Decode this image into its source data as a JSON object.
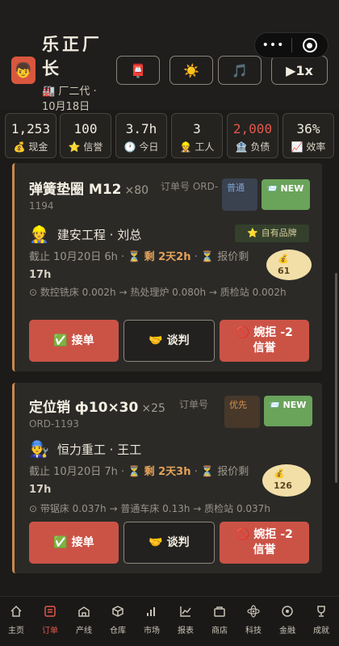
{
  "header": {
    "title": "乐正厂长",
    "subtitle_factory_emoji": "🏭",
    "subtitle_line": "厂二代 ·",
    "date": "10月18日",
    "avatar_emoji": "👦",
    "buttons": {
      "mail": "📮",
      "weather": "☀️",
      "music": "🎵",
      "speed": "▶1x"
    },
    "capsule_dots": "•••"
  },
  "stats": [
    {
      "value": "1,253",
      "icon": "💰",
      "label": "现金"
    },
    {
      "value": "100",
      "icon": "⭐",
      "label": "信誉"
    },
    {
      "value": "3.7h",
      "icon": "🕐",
      "label": "今日"
    },
    {
      "value": "3",
      "icon": "👷",
      "label": "工人"
    },
    {
      "value": "2,000",
      "icon": "🏦",
      "label": "负债",
      "color": "#e2574a"
    },
    {
      "value": "36%",
      "icon": "📈",
      "label": "效率"
    }
  ],
  "orders": [
    {
      "title": "弹簧垫圈 M12",
      "qty": "×80",
      "order_label": "订单号 ORD-",
      "order_num": "1194",
      "tag_priority": "普通",
      "tag_new": "📨 NEW",
      "client_emoji": "👷",
      "client": "建安工程 · 刘总",
      "brand": "⭐ 自有品牌",
      "deadline_prefix": "截止 10月20日 6h · ⏳",
      "remaining": "剩 2天2h",
      "quote_prefix": "· ⏳ 报价剩",
      "quote_time": "17h",
      "price_icon": "💰",
      "price": "61",
      "route": "⊙ 数控铣床 0.002h → 热处理炉 0.080h → 质检站 0.002h",
      "accept": "✅ 接单",
      "negotiate": "🤝 谈判",
      "reject": "🚫 婉拒 -2 信誉"
    },
    {
      "title": "定位销 ф10×30",
      "qty": "×25",
      "order_label": "订单号",
      "order_num": "ORD-1193",
      "tag_priority": "优先",
      "tag_new": "📨 NEW",
      "client_emoji": "👨‍🔧",
      "client": "恒力重工 · 王工",
      "deadline_prefix": "截止 10月20日 7h · ⏳",
      "remaining": "剩 2天3h",
      "quote_prefix": "· ⏳ 报价剩",
      "quote_time": "17h",
      "price_icon": "💰",
      "price": "126",
      "route": "⊙ 带锯床 0.037h → 普通车床 0.13h → 质检站 0.037h",
      "accept": "✅ 接单",
      "negotiate": "🤝 谈判",
      "reject": "🚫 婉拒 -2 信誉"
    }
  ],
  "nav": [
    {
      "label": "主页",
      "icon": "home-icon"
    },
    {
      "label": "订单",
      "icon": "orders-icon",
      "active": true
    },
    {
      "label": "产线",
      "icon": "factory-icon"
    },
    {
      "label": "仓库",
      "icon": "warehouse-icon"
    },
    {
      "label": "市场",
      "icon": "market-icon"
    },
    {
      "label": "报表",
      "icon": "report-icon"
    },
    {
      "label": "商店",
      "icon": "shop-icon"
    },
    {
      "label": "科技",
      "icon": "tech-icon"
    },
    {
      "label": "金融",
      "icon": "finance-icon"
    },
    {
      "label": "成就",
      "icon": "trophy-icon"
    }
  ]
}
